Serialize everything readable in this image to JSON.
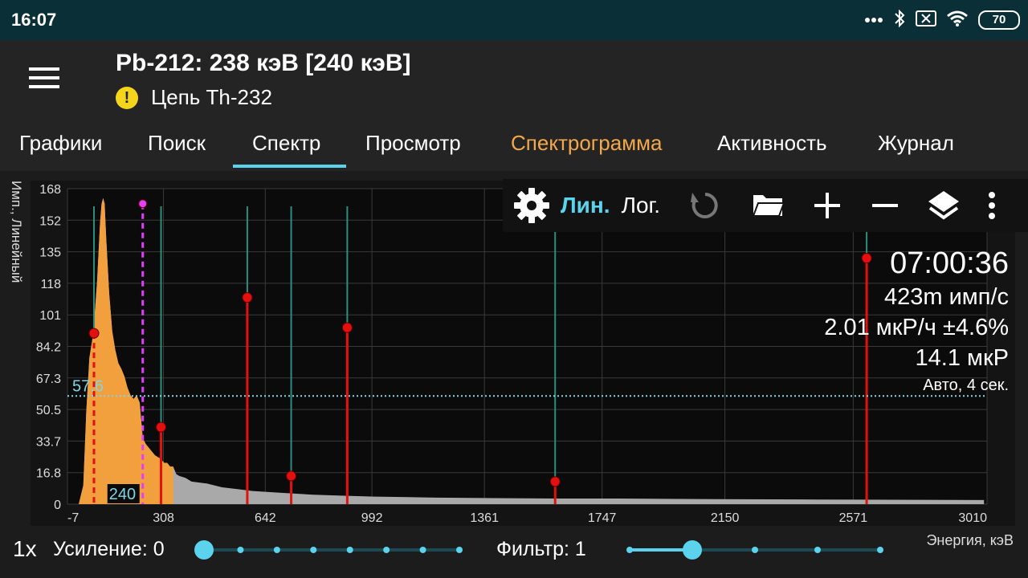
{
  "status_bar": {
    "time": "16:07",
    "battery": "70",
    "icons": [
      "more-dots-icon",
      "bluetooth-icon",
      "sim-off-icon",
      "wifi-icon",
      "battery-icon"
    ]
  },
  "app_bar": {
    "title": "Pb-212: 238 кэВ [240 кэВ]",
    "subtitle": "Цепь Th-232",
    "menu_icon": "hamburger-menu-icon",
    "info_icon": "warning-info-icon"
  },
  "tabs": [
    {
      "label": "Графики",
      "active": false
    },
    {
      "label": "Поиск",
      "active": false
    },
    {
      "label": "Спектр",
      "active": true
    },
    {
      "label": "Просмотр",
      "active": false
    },
    {
      "label": "Спектрограмма",
      "active": false,
      "highlight": true
    },
    {
      "label": "Активность",
      "active": false
    },
    {
      "label": "Журнал",
      "active": false
    }
  ],
  "colors": {
    "accent": "#5bd3ec",
    "highlight_tab": "#f2a84b",
    "spectrum_roi": "#f2a03d",
    "spectrum_bg": "#a9a9a9",
    "marker_red": "#e3100f",
    "marker_teal": "#2a8f7f",
    "cursor_magenta": "#e040fb",
    "dotted_level": "#7fd6e6"
  },
  "toolbar": {
    "settings_icon": "gear-icon",
    "lin_label": "Лин.",
    "log_label": "Лог.",
    "reset_icon": "refresh-icon",
    "open_icon": "folder-open-icon",
    "zoom_in_icon": "plus-icon",
    "zoom_out_icon": "minus-icon",
    "layers_icon": "layers-icon",
    "more_icon": "more-vert-icon"
  },
  "readouts": {
    "elapsed": "07:00:36",
    "count_rate": "423m имп/с",
    "dose_rate": "2.01 мкР/ч ±4.6%",
    "dose": "14.1 мкР",
    "mode": "Авто, 4 сек."
  },
  "chart_data": {
    "type": "area",
    "ylabel": "Имп., Линейный",
    "xlabel": "Энергия, кэВ",
    "y_scale": "linear",
    "ylim": [
      0,
      168
    ],
    "xlim": [
      -7,
      3010
    ],
    "y_ticks": [
      "0",
      "16.8",
      "33.7",
      "50.5",
      "67.3",
      "84.2",
      "101",
      "118",
      "135",
      "152",
      "168"
    ],
    "x_ticks": [
      "-7",
      "308",
      "642",
      "992",
      "1361",
      "1747",
      "2150",
      "2571",
      "3010"
    ],
    "grid": true,
    "cursor_energy_label": "240",
    "level_label": "57.6",
    "level_value": 57.6,
    "cursor_energy": 240,
    "roi_end_energy": 344,
    "spectrum": {
      "x": [
        30,
        45,
        55,
        65,
        75,
        80,
        90,
        100,
        105,
        110,
        115,
        120,
        130,
        140,
        150,
        160,
        170,
        180,
        190,
        200,
        210,
        220,
        230,
        240,
        250,
        260,
        270,
        280,
        290,
        300,
        310,
        320,
        330,
        340,
        350,
        360,
        380,
        400,
        450,
        500,
        550,
        600,
        700,
        800,
        900,
        1000,
        1200,
        1400,
        1600,
        1800,
        2000,
        2200,
        2400,
        2600,
        2800,
        3000
      ],
      "values": [
        0,
        10,
        50,
        78,
        88,
        96,
        118,
        150,
        160,
        163,
        160,
        142,
        112,
        92,
        82,
        75,
        72,
        68,
        62,
        58,
        56,
        58,
        54,
        35,
        32,
        30,
        28,
        26,
        25,
        24,
        22,
        22,
        20,
        20,
        16,
        15,
        14,
        12,
        11,
        9,
        8,
        7,
        6,
        5,
        4.5,
        4,
        3.5,
        3.2,
        3,
        3,
        2.8,
        2.6,
        2.5,
        2.4,
        2.3,
        2.2
      ]
    },
    "markers": [
      {
        "energy": 80,
        "value": 91,
        "color": "red",
        "dashed": true
      },
      {
        "energy": 240,
        "value": 160,
        "color": "magenta",
        "dashed": true
      },
      {
        "energy": 300,
        "value": 41,
        "color": "red",
        "dashed": false
      },
      {
        "energy": 583,
        "value": 110,
        "color": "red",
        "dashed": false
      },
      {
        "energy": 727,
        "value": 15,
        "color": "red",
        "dashed": false
      },
      {
        "energy": 911,
        "value": 94,
        "color": "red",
        "dashed": false
      },
      {
        "energy": 1593,
        "value": 12,
        "color": "red",
        "dashed": false
      },
      {
        "energy": 2615,
        "value": 131,
        "color": "red",
        "dashed": false
      }
    ]
  },
  "controls": {
    "zoom": "1x",
    "gain_label": "Усиление: 0",
    "filter_label": "Фильтр: 1",
    "gain_value": 0,
    "gain_steps": 8,
    "filter_value": 1,
    "filter_steps": 5
  }
}
